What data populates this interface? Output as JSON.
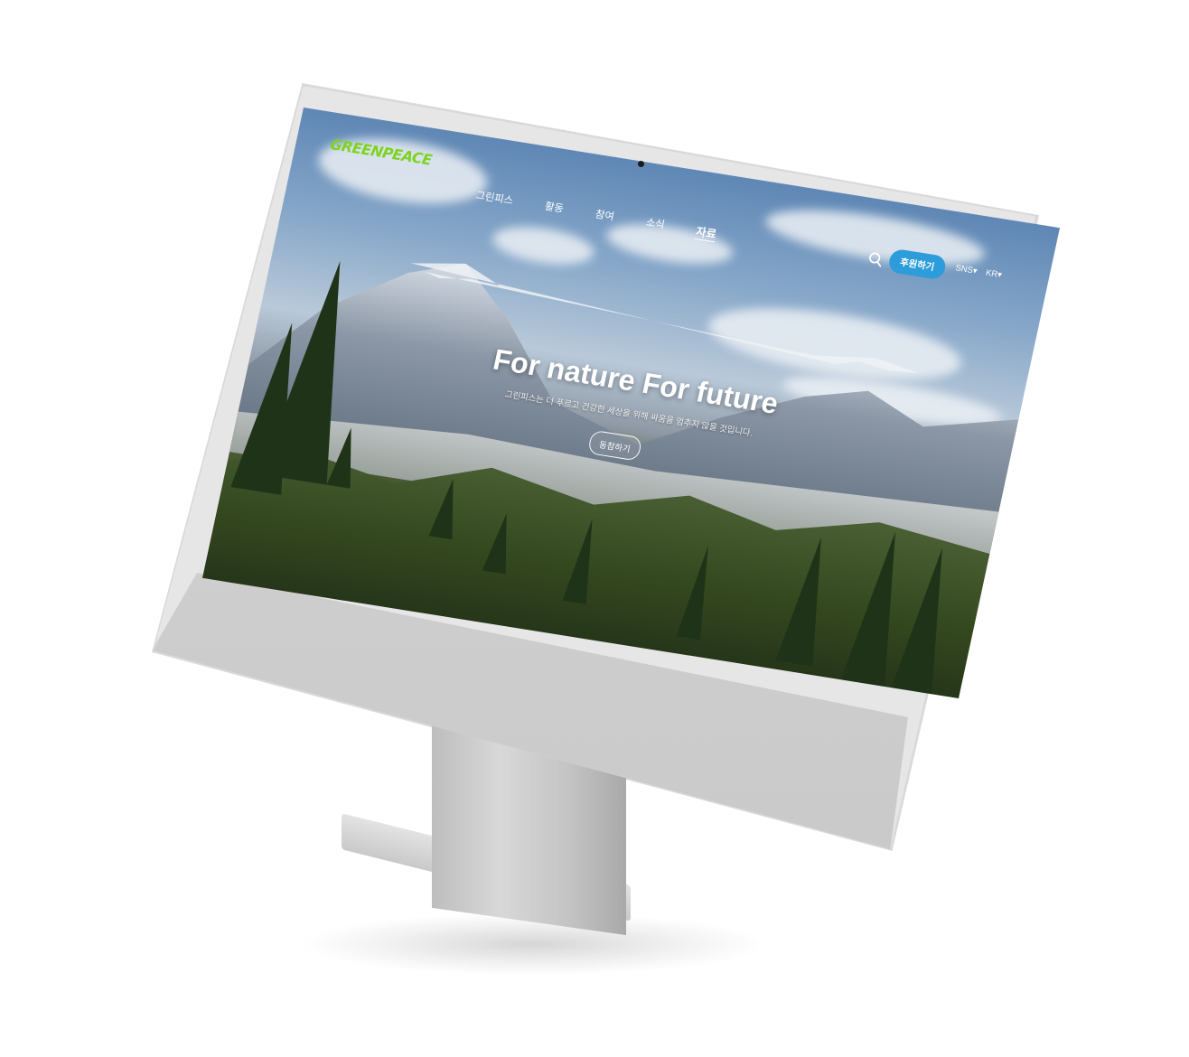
{
  "site": {
    "logo_text": "GREENPEACE",
    "brand_color": "#7ed321"
  },
  "nav": {
    "items": [
      {
        "label": "그린피스",
        "active": false
      },
      {
        "label": "활동",
        "active": false
      },
      {
        "label": "참여",
        "active": false
      },
      {
        "label": "소식",
        "active": false
      },
      {
        "label": "자료",
        "active": true
      }
    ]
  },
  "header": {
    "search_icon": "search-icon",
    "donate_label": "후원하기",
    "donate_color": "#2d9cdb",
    "sns_label": "SNS▾",
    "lang_label": "KR▾"
  },
  "hero": {
    "title": "For nature For future",
    "subtitle": "그린피스는 더 푸르고 건강한 세상을 위해 싸움을 멈추지 않을 것입니다.",
    "cta_label": "동참하기"
  },
  "device": {
    "type": "imac",
    "color": "#e6e6e6"
  }
}
